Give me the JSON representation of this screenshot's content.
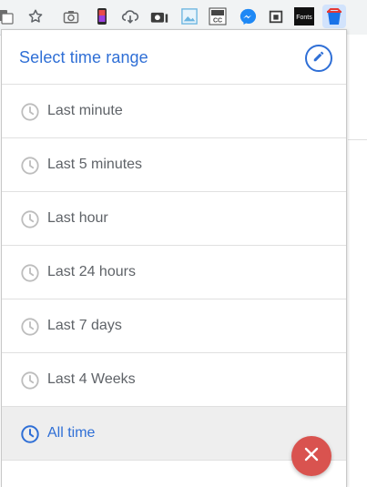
{
  "toolbar": {
    "icons": [
      "translate-icon",
      "star-icon",
      "camera-icon",
      "phone-icon",
      "cloud-download-icon",
      "screenshot-icon",
      "image-icon",
      "closed-captions-icon",
      "messenger-icon",
      "package-icon",
      "fonts-icon",
      "bucket-icon"
    ],
    "fonts_ext_label": "Fonts",
    "cc_label": "CC"
  },
  "popup": {
    "title": "Select time range",
    "ranges": [
      {
        "label": "Last minute"
      },
      {
        "label": "Last 5 minutes"
      },
      {
        "label": "Last hour"
      },
      {
        "label": "Last 24 hours"
      },
      {
        "label": "Last 7 days"
      },
      {
        "label": "Last 4 Weeks"
      },
      {
        "label": "All time",
        "selected": true
      }
    ]
  },
  "colors": {
    "accent": "#2f6fd6",
    "item_text": "#5f6368",
    "divider": "#e0e0e0",
    "selected_bg": "#eeeeee",
    "close_button": "#d9534f"
  }
}
